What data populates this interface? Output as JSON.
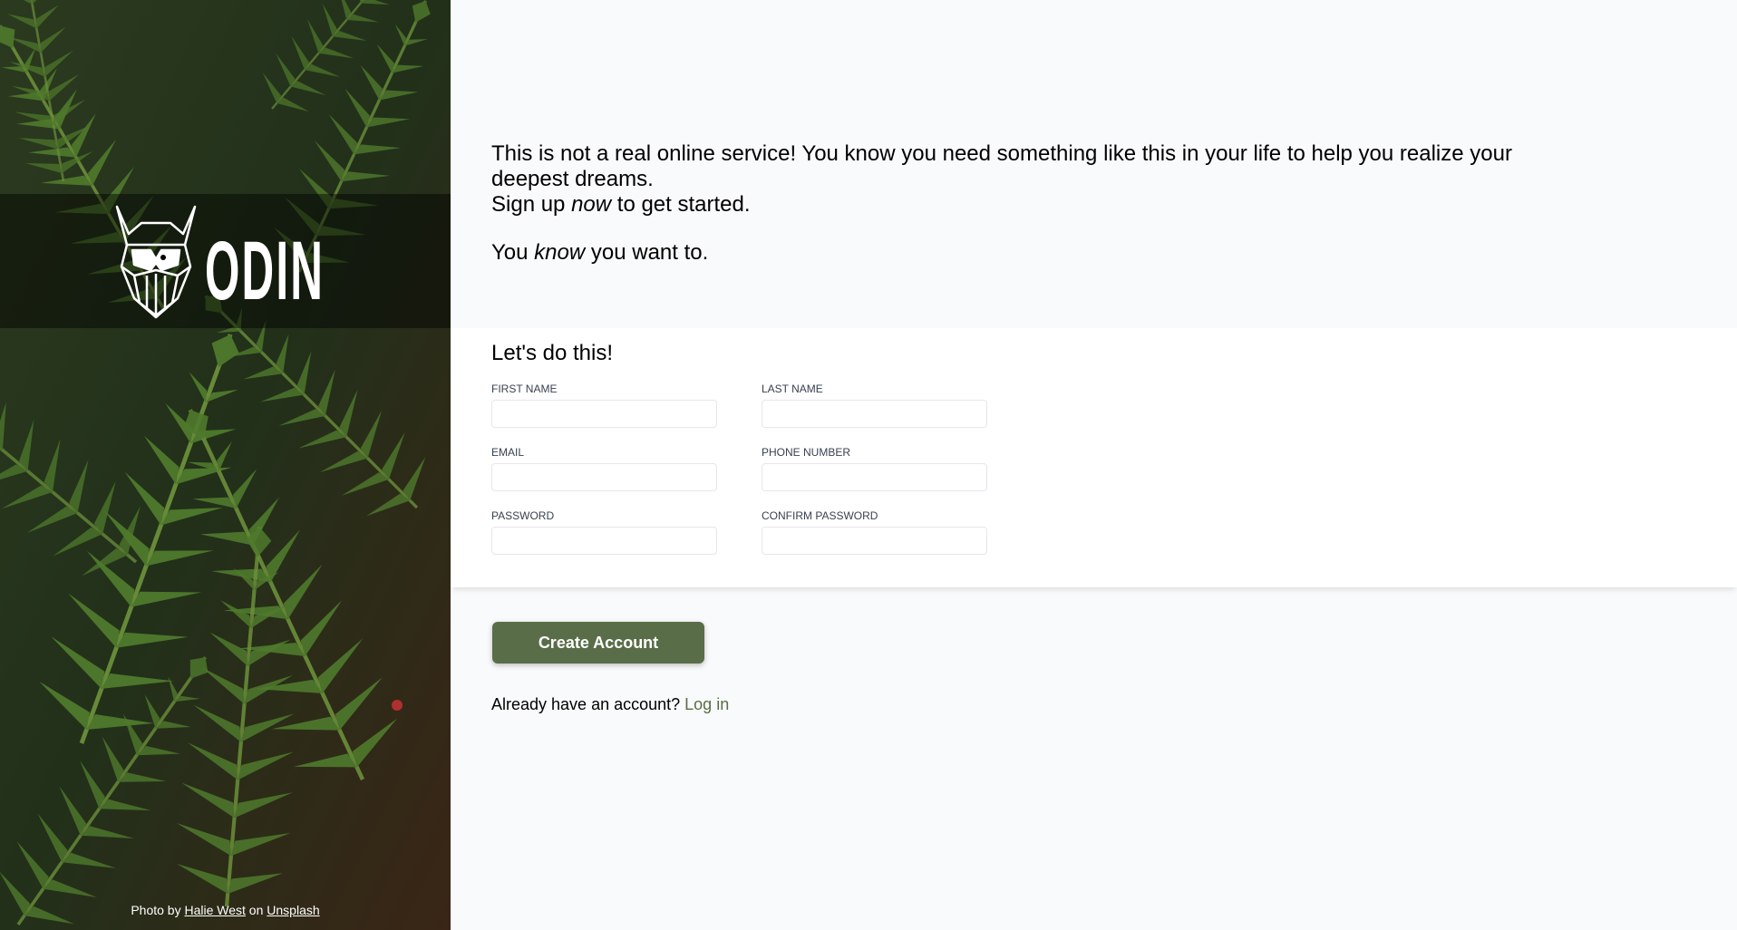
{
  "brand": {
    "logo_text": "ODIN"
  },
  "intro": {
    "line1": "This is not a real online service! You know you need something like this in your life to help you realize your deepest dreams.",
    "signup_prefix": "Sign up ",
    "signup_emphasis": "now",
    "signup_suffix": " to get started.",
    "know_prefix": "You ",
    "know_emphasis": "know",
    "know_suffix": " you want to."
  },
  "form": {
    "title": "Let's do this!",
    "fields": [
      {
        "label": "FIRST NAME",
        "value": "",
        "placeholder": ""
      },
      {
        "label": "LAST NAME",
        "value": "",
        "placeholder": ""
      },
      {
        "label": "EMAIL",
        "value": "",
        "placeholder": ""
      },
      {
        "label": "PHONE NUMBER",
        "value": "",
        "placeholder": ""
      },
      {
        "label": "PASSWORD",
        "value": "",
        "placeholder": ""
      },
      {
        "label": "CONFIRM PASSWORD",
        "value": "",
        "placeholder": ""
      }
    ]
  },
  "actions": {
    "create_label": "Create Account",
    "login_prompt": "Already have an account? ",
    "login_link": "Log in"
  },
  "credit": {
    "prefix": "Photo by ",
    "author": "Halie West",
    "middle": " on ",
    "source": "Unsplash"
  },
  "colors": {
    "accent": "#596d48",
    "page_background": "#f9fafb",
    "card_background": "#ffffff",
    "input_border": "#e5e7eb"
  },
  "icons": {
    "logo": "viking-head-icon",
    "photo": "fern-leaves-photo"
  }
}
